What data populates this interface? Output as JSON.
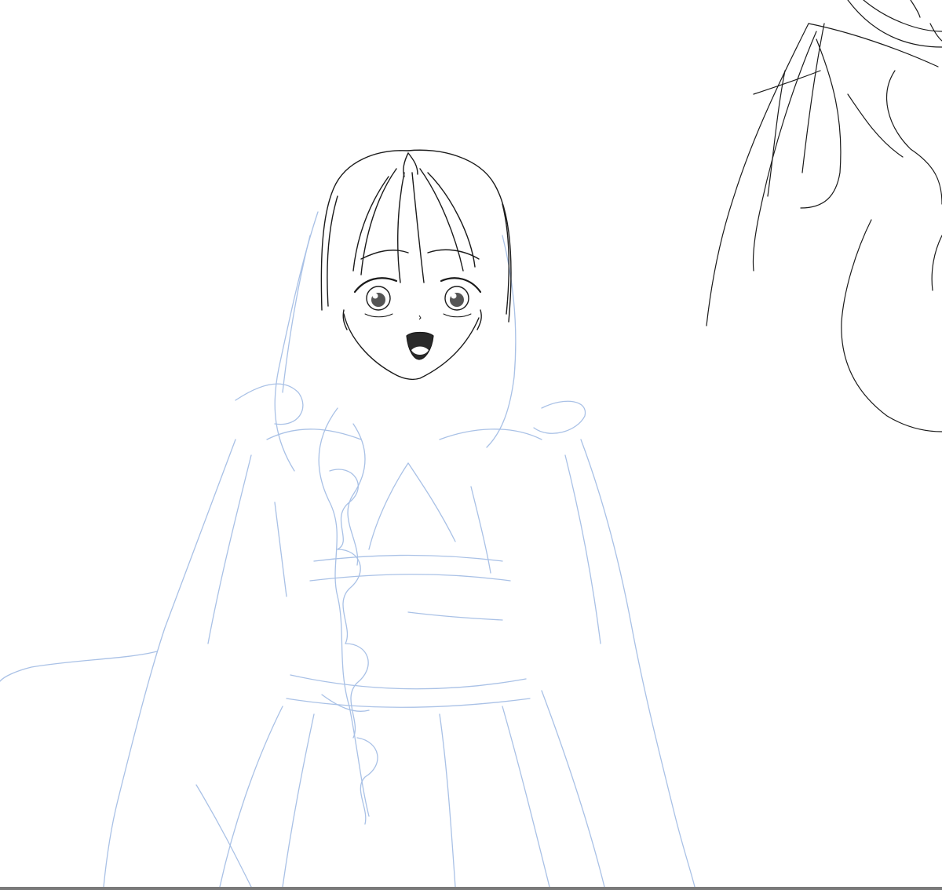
{
  "canvas": {
    "background_color": "#ffffff",
    "ink_color": "#1a1a1a",
    "sketch_color": "#a9c1e6",
    "edge_color": "#7a7a7a"
  }
}
